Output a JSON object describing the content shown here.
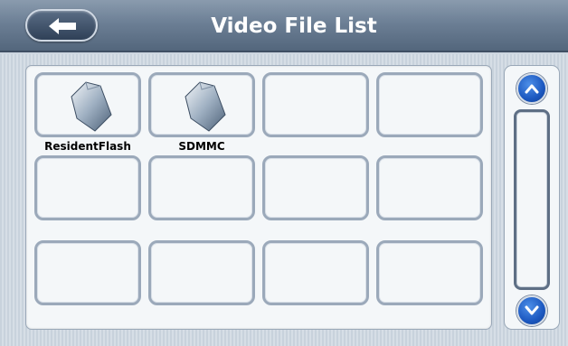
{
  "header": {
    "title": "Video File List",
    "back_icon": "left-arrow-icon"
  },
  "grid": {
    "items": [
      {
        "label": "ResidentFlash",
        "icon": "storage-card-icon"
      },
      {
        "label": "SDMMC",
        "icon": "storage-card-icon"
      },
      {
        "label": ""
      },
      {
        "label": ""
      },
      {
        "label": ""
      },
      {
        "label": ""
      },
      {
        "label": ""
      },
      {
        "label": ""
      },
      {
        "label": ""
      },
      {
        "label": ""
      },
      {
        "label": ""
      },
      {
        "label": ""
      }
    ]
  },
  "scrollbar": {
    "up_icon": "chevron-up-icon",
    "down_icon": "chevron-down-icon"
  },
  "colors": {
    "title_bar": "#6c7f95",
    "accent_blue": "#1c58c0",
    "cell_border": "#9ba9ba"
  }
}
